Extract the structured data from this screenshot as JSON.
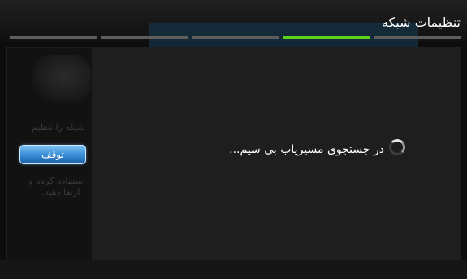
{
  "header": {
    "title": "تنظیمات شبکه",
    "steps": [
      {
        "active": false
      },
      {
        "active": false
      },
      {
        "active": false
      },
      {
        "active": true
      },
      {
        "active": false
      }
    ]
  },
  "background": {
    "text_line_1": "شبکه را تنظیم",
    "text_line_2": "استفاده کرده و",
    "text_line_3": "ا ارتقا دهید."
  },
  "buttons": {
    "stop_label": "توقف"
  },
  "dialog": {
    "status": "در جستجوی مسیریاب بی سیم..."
  },
  "colors": {
    "accent_progress": "#5fd21f",
    "button_blue": "#3a8fd7"
  },
  "icons": {
    "spinner": "loading-spinner-icon"
  }
}
